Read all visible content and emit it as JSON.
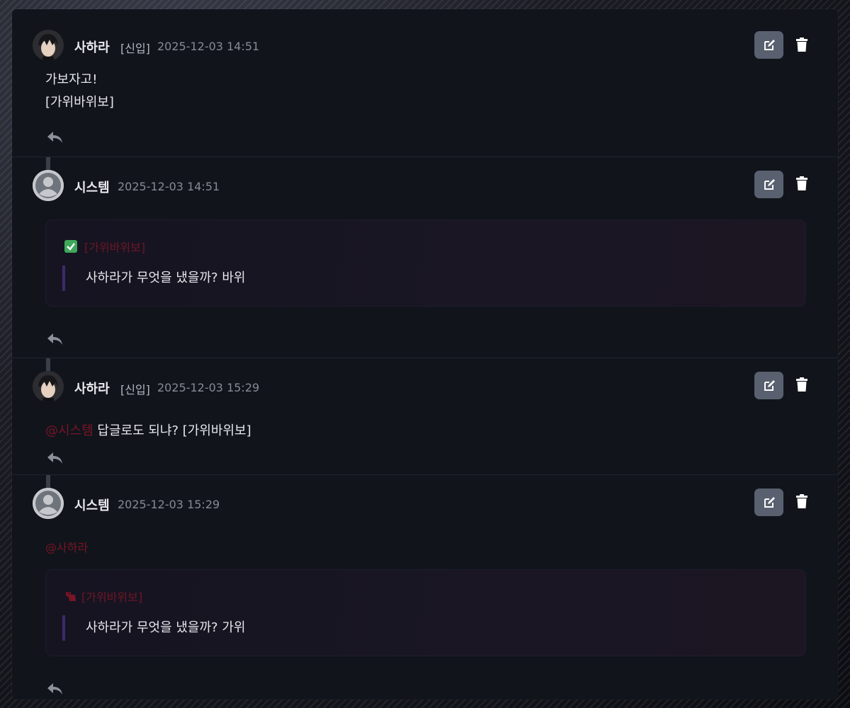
{
  "comments": [
    {
      "author": "사하라",
      "rank": "[신입]",
      "time": "2025-12-03 14:51",
      "lines": [
        "가보자고!",
        "[가위바위보]"
      ]
    },
    {
      "author": "시스템",
      "time": "2025-12-03 14:51",
      "dice": {
        "title": "[가위바위보]",
        "result": "사하라가 무엇을 냈을까? 바위"
      }
    },
    {
      "author": "사하라",
      "rank": "[신입]",
      "time": "2025-12-03 15:29",
      "mention": "@시스템",
      "text": " 답글로도 되냐? [가위바위보]"
    },
    {
      "author": "시스템",
      "time": "2025-12-03 15:29",
      "mention": "@사하라",
      "dice": {
        "title": "[가위바위보]",
        "result": "사하라가 무엇을 냈을까? 가위"
      }
    }
  ],
  "icons": {
    "edit": "edit-icon",
    "delete": "trash-icon",
    "reply": "reply-icon",
    "check": "check-icon",
    "mark": "marker-icon"
  },
  "colors": {
    "mention": "#7a1426",
    "edit_button": "#596170",
    "check": "#3fa85a"
  }
}
